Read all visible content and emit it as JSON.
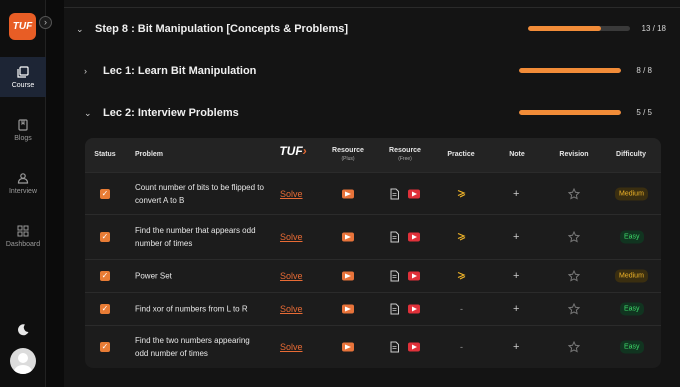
{
  "sidebar": {
    "logo": "TUF",
    "items": [
      {
        "label": "Course",
        "icon": "book-stack-icon"
      },
      {
        "label": "Blogs",
        "icon": "bookmark-icon"
      },
      {
        "label": "Interview",
        "icon": "interview-person-icon"
      },
      {
        "label": "Dashboard",
        "icon": "dashboard-grid-icon"
      }
    ]
  },
  "step": {
    "title": "Step 8 : Bit Manipulation [Concepts & Problems]",
    "progress": "13 / 18",
    "fraction": 0.722
  },
  "lectures": [
    {
      "title": "Lec 1: Learn Bit Manipulation",
      "progress": "8 / 8",
      "fraction": 1.0
    },
    {
      "title": "Lec 2: Interview Problems",
      "progress": "5 / 5",
      "fraction": 1.0
    }
  ],
  "table": {
    "headers": {
      "status": "Status",
      "problem": "Problem",
      "brand": "TUF",
      "resource_plus": "Resource",
      "resource_plus_sub": "(Plus)",
      "resource_free": "Resource",
      "resource_free_sub": "(Free)",
      "practice": "Practice",
      "note": "Note",
      "revision": "Revision",
      "difficulty": "Difficulty"
    },
    "rows": [
      {
        "problem": "Count number of bits to be flipped to convert A to B",
        "solve": "Solve",
        "practice": "icon",
        "note": "+",
        "difficulty": "Medium",
        "checked": true
      },
      {
        "problem": "Find the number that appears odd number of times",
        "solve": "Solve",
        "practice": "icon",
        "note": "+",
        "difficulty": "Easy",
        "checked": true
      },
      {
        "problem": "Power Set",
        "solve": "Solve",
        "practice": "icon",
        "note": "+",
        "difficulty": "Medium",
        "checked": true
      },
      {
        "problem": "Find xor of numbers from L to R",
        "solve": "Solve",
        "practice": "-",
        "note": "+",
        "difficulty": "Easy",
        "checked": true
      },
      {
        "problem": "Find the two numbers appearing odd number of times",
        "solve": "Solve",
        "practice": "-",
        "note": "+",
        "difficulty": "Easy",
        "checked": true
      }
    ]
  },
  "colors": {
    "accent": "#f28c38",
    "medium": "#f0b429",
    "easy": "#3ddc6a"
  }
}
